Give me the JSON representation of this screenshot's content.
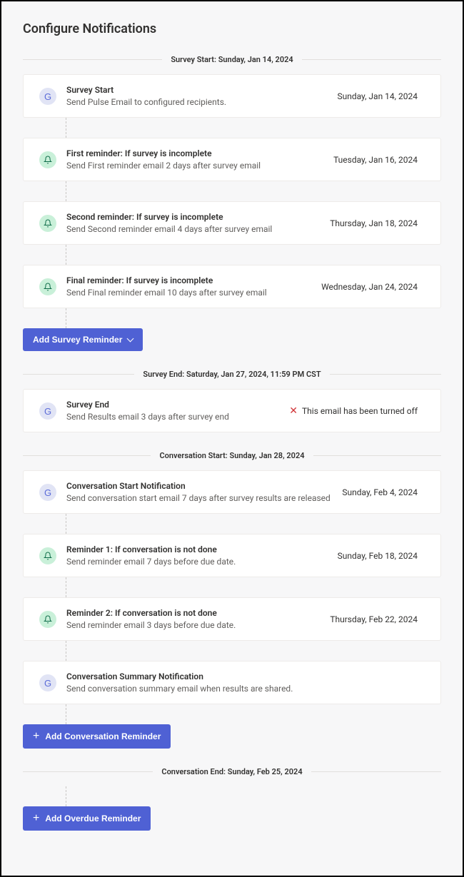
{
  "page_title": "Configure Notifications",
  "sections": [
    {
      "divider": "Survey Start: Sunday, Jan 14, 2024",
      "cards": [
        {
          "icon": "g",
          "title": "Survey Start",
          "desc": "Send Pulse Email to configured recipients.",
          "date": "Sunday, Jan 14, 2024"
        },
        {
          "icon": "bell",
          "title": "First reminder: If survey is incomplete",
          "desc": "Send First reminder email 2 days after survey email",
          "date": "Tuesday, Jan 16, 2024"
        },
        {
          "icon": "bell",
          "title": "Second reminder: If survey is incomplete",
          "desc": "Send Second reminder email 4 days after survey email",
          "date": "Thursday, Jan 18, 2024"
        },
        {
          "icon": "bell",
          "title": "Final reminder: If survey is incomplete",
          "desc": "Send Final reminder email 10 days after survey email",
          "date": "Wednesday, Jan 24, 2024"
        }
      ],
      "button": {
        "label": "Add Survey Reminder",
        "style": "chevron"
      }
    },
    {
      "divider": "Survey End: Saturday, Jan 27, 2024, 11:59 PM CST",
      "cards": [
        {
          "icon": "g",
          "title": "Survey End",
          "desc": "Send Results email 3 days after survey end",
          "off_text": "This email has been turned off"
        }
      ]
    },
    {
      "divider": "Conversation Start: Sunday, Jan 28, 2024",
      "cards": [
        {
          "icon": "g",
          "title": "Conversation Start Notification",
          "desc": "Send conversation start email 7 days after survey results are released",
          "date": "Sunday, Feb 4, 2024"
        },
        {
          "icon": "bell",
          "title": "Reminder 1: If conversation is not done",
          "desc": "Send reminder email 7 days before due date.",
          "date": "Sunday, Feb 18, 2024"
        },
        {
          "icon": "bell",
          "title": "Reminder 2: If conversation is not done",
          "desc": "Send reminder email 3 days before due date.",
          "date": "Thursday, Feb 22, 2024"
        },
        {
          "icon": "g",
          "title": "Conversation Summary Notification",
          "desc": "Send conversation summary email when results are shared."
        }
      ],
      "button": {
        "label": "Add Conversation Reminder",
        "style": "plus"
      }
    },
    {
      "divider": "Conversation End: Sunday, Feb 25, 2024",
      "cards": [],
      "button": {
        "label": "Add Overdue Reminder",
        "style": "plus"
      }
    }
  ]
}
